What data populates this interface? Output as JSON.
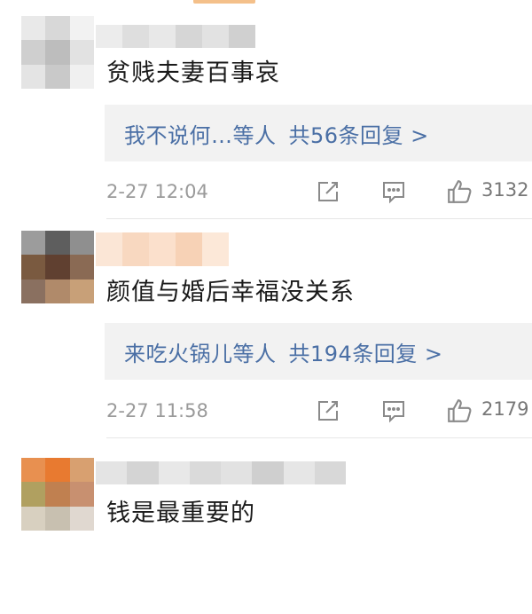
{
  "comments": [
    {
      "text": "贫贱夫妻百事哀",
      "replies": {
        "users": "我不说何…等人",
        "count": "共56条回复 >"
      },
      "time": "2-27 12:04",
      "likes": "3132"
    },
    {
      "text": "颜值与婚后幸福没关系",
      "replies": {
        "users": "来吃火锅儿等人",
        "count": "共194条回复 >"
      },
      "time": "2-27 11:58",
      "likes": "2179"
    },
    {
      "text": "钱是最重要的"
    }
  ],
  "icons": {
    "share": "share-edit-icon",
    "comment": "comment-bubble-icon",
    "like": "thumbs-up-icon"
  },
  "colors": {
    "reply_link": "#4a6fa5",
    "reply_bg": "#f2f2f2",
    "meta_text": "#9a9a9a"
  }
}
